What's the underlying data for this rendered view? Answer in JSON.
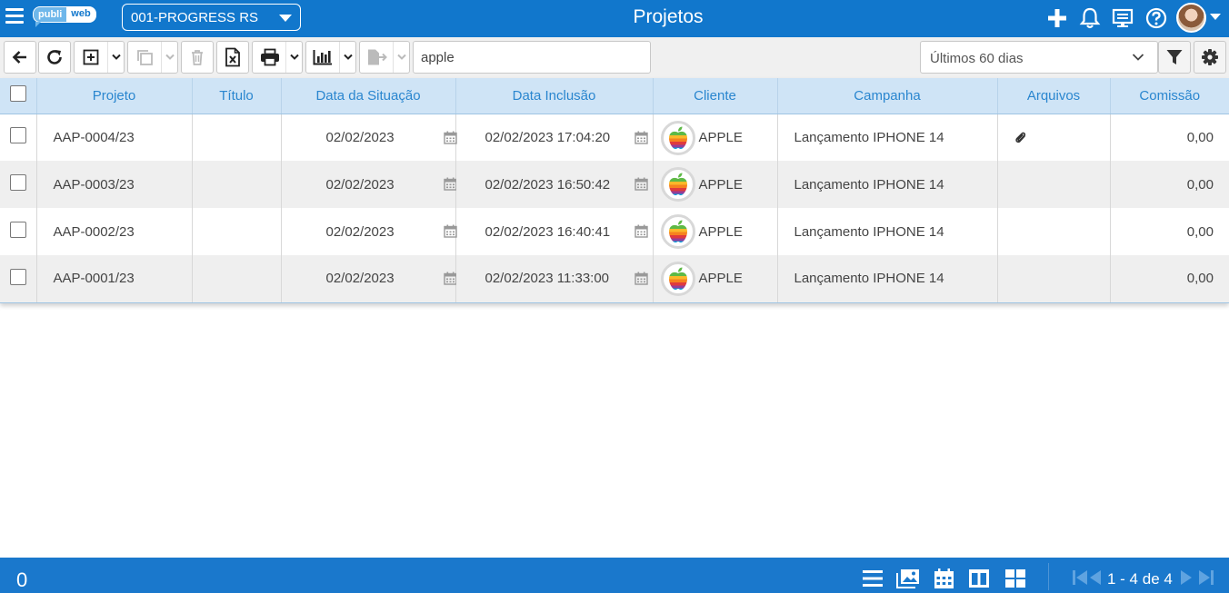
{
  "header": {
    "logo_left": "publi",
    "logo_right": "web",
    "company": "001-PROGRESS RS",
    "title": "Projetos"
  },
  "toolbar": {
    "search_value": "apple",
    "period": "Últimos 60 dias"
  },
  "table": {
    "columns": [
      "Projeto",
      "Título",
      "Data da Situação",
      "Data Inclusão",
      "Cliente",
      "Campanha",
      "Arquivos",
      "Comissão"
    ],
    "rows": [
      {
        "projeto": "AAP-0004/23",
        "titulo": "",
        "data_situacao": "02/02/2023",
        "data_inclusao": "02/02/2023 17:04:20",
        "cliente": "APPLE",
        "campanha": "Lançamento IPHONE 14",
        "arquivos": true,
        "comissao": "0,00"
      },
      {
        "projeto": "AAP-0003/23",
        "titulo": "",
        "data_situacao": "02/02/2023",
        "data_inclusao": "02/02/2023 16:50:42",
        "cliente": "APPLE",
        "campanha": "Lançamento IPHONE 14",
        "arquivos": false,
        "comissao": "0,00"
      },
      {
        "projeto": "AAP-0002/23",
        "titulo": "",
        "data_situacao": "02/02/2023",
        "data_inclusao": "02/02/2023 16:40:41",
        "cliente": "APPLE",
        "campanha": "Lançamento IPHONE 14",
        "arquivos": false,
        "comissao": "0,00"
      },
      {
        "projeto": "AAP-0001/23",
        "titulo": "",
        "data_situacao": "02/02/2023",
        "data_inclusao": "02/02/2023 11:33:00",
        "cliente": "APPLE",
        "campanha": "Lançamento IPHONE 14",
        "arquivos": false,
        "comissao": "0,00"
      }
    ]
  },
  "footer": {
    "selected_count": "0",
    "pager": "1 - 4 de 4"
  },
  "icons": {
    "header": [
      "menu-icon",
      "plus-icon",
      "bell-icon",
      "monitor-icon",
      "help-icon",
      "avatar"
    ],
    "toolbar": [
      "back-arrow-icon",
      "refresh-icon",
      "add-box-icon",
      "copy-icon",
      "trash-icon",
      "excel-icon",
      "printer-icon",
      "chart-icon",
      "export-icon",
      "filter-icon",
      "gear-icon"
    ],
    "footer": [
      "list-view-icon",
      "gallery-view-icon",
      "calendar-view-icon",
      "columns-view-icon",
      "grid-view-icon",
      "first-page-icon",
      "prev-page-icon",
      "next-page-icon",
      "last-page-icon"
    ]
  },
  "colors": {
    "primary": "#1177cc",
    "table_header": "#cfe4f6",
    "table_header_text": "#2a86cf",
    "row_alt": "#efefef"
  }
}
